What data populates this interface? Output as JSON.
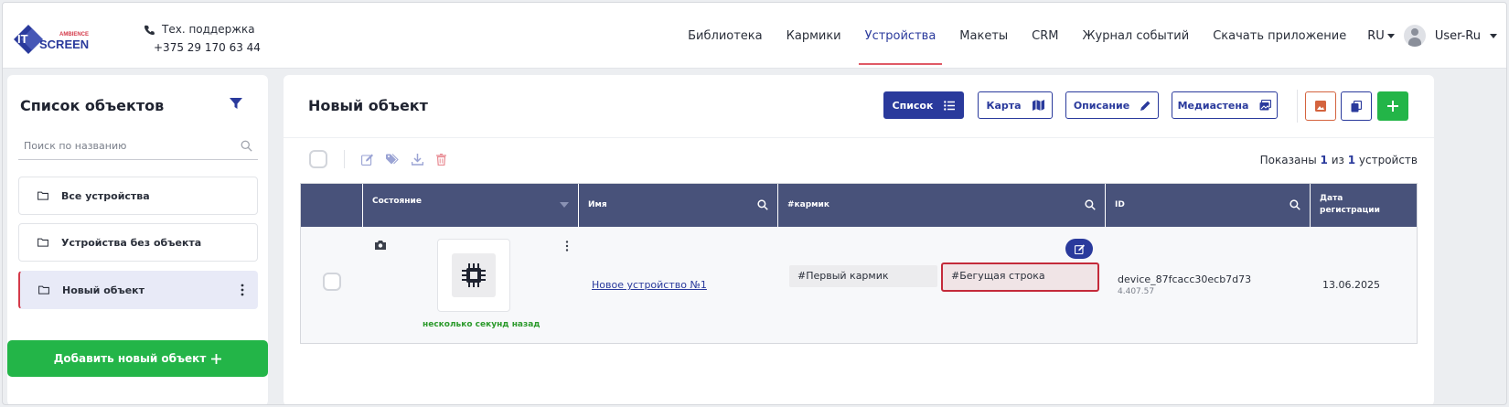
{
  "header": {
    "logo": {
      "it": "IT",
      "ambience": "AMBIENCE",
      "screen": "SCREEN"
    },
    "support_label": "Тех. поддержка",
    "support_phone": "+375 29 170 63 44",
    "nav": [
      "Библиотека",
      "Кармики",
      "Устройства",
      "Макеты",
      "CRM",
      "Журнал событий",
      "Скачать приложение"
    ],
    "active_nav": "Устройства",
    "lang": "RU",
    "user": "User-Ru"
  },
  "sidebar": {
    "title": "Список объектов",
    "search_placeholder": "Поиск по названию",
    "items": [
      {
        "label": "Все устройства"
      },
      {
        "label": "Устройства без объекта"
      },
      {
        "label": "Новый объект"
      }
    ],
    "add_button": "Добавить новый объект"
  },
  "main": {
    "title": "Новый объект",
    "view_buttons": [
      "Список",
      "Карта",
      "Описание",
      "Медиастена"
    ],
    "shown": {
      "prefix": "Показаны",
      "shown": "1",
      "of": "из",
      "total": "1",
      "suffix": "устройств"
    },
    "table": {
      "columns": [
        "Состояние",
        "Имя",
        "#кармик",
        "ID",
        "Дата регистрации"
      ],
      "rows": [
        {
          "status_time": "несколько секунд назад",
          "name": "Новое устройство №1",
          "tags": [
            "#Первый кармик",
            "#Бегущая строка"
          ],
          "device_id": "device_87fcacc30ecb7d73",
          "version": "4.407.57",
          "registered": "13.06.2025"
        }
      ]
    }
  },
  "colors": {
    "primary": "#2a3a9c",
    "accent_red": "#c42a3a",
    "success": "#23b548",
    "table_header": "#48527a"
  }
}
